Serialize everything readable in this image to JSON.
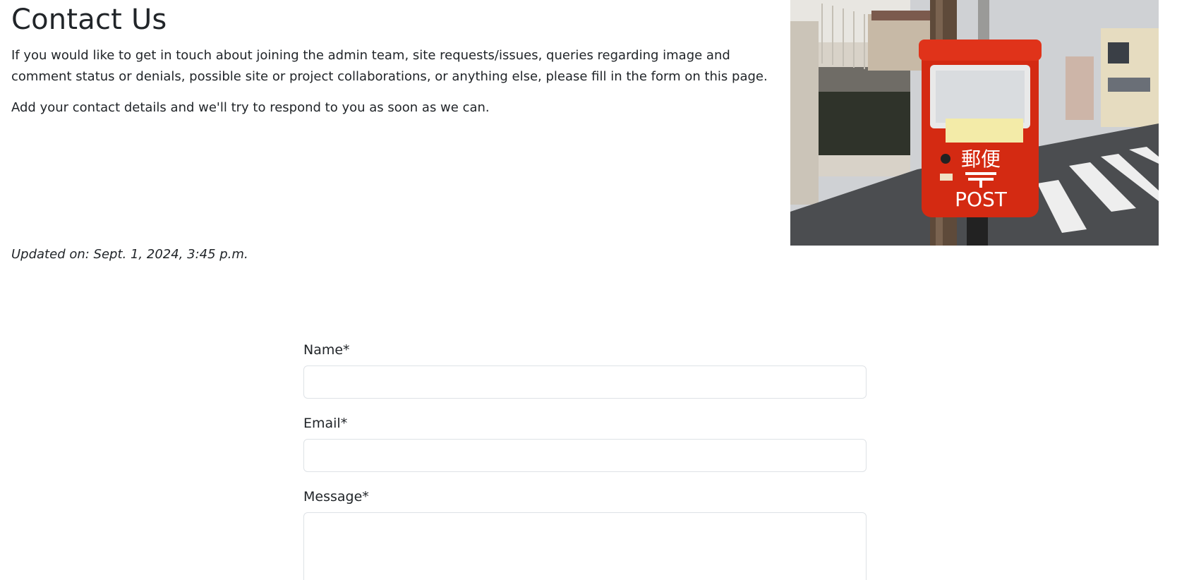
{
  "intro": {
    "title": "Contact Us",
    "paragraph_1": "If you would like to get in touch about joining the admin team, site requests/issues, queries regarding image and comment status or denials, possible site or project collaborations, or anything else, please fill in the form on this page.",
    "paragraph_2": "Add your contact details and we'll try to respond to you as soon as we can.",
    "updated": "Updated on: Sept. 1, 2024, 3:45 p.m."
  },
  "photo": {
    "sign_text_1": "郵便",
    "sign_text_2": "POST",
    "colors": {
      "mailbox_red": "#d42a12",
      "sky": "#c9cbce",
      "road": "#4a4c4e"
    }
  },
  "form": {
    "name_label": "Name*",
    "name_value": "",
    "email_label": "Email*",
    "email_value": "",
    "message_label": "Message*",
    "message_value": ""
  }
}
